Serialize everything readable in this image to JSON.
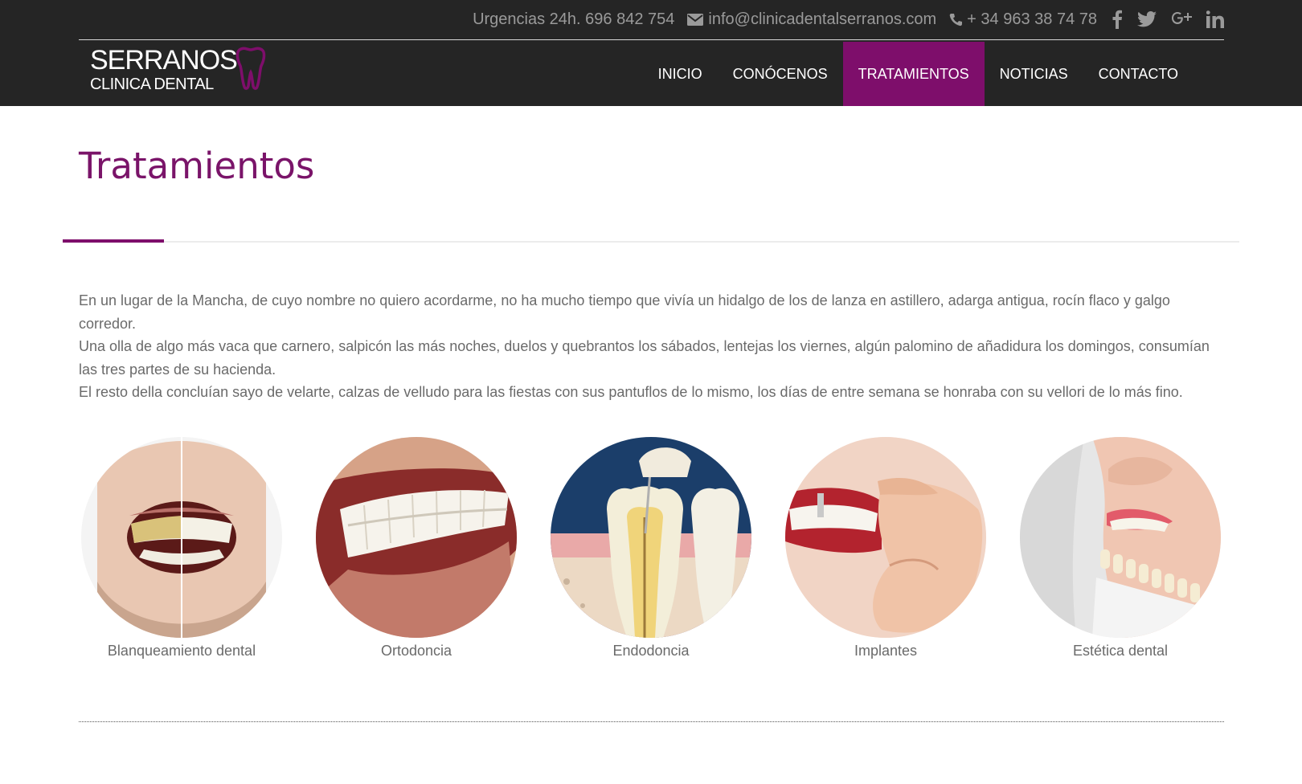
{
  "topbar": {
    "emergency": "Urgencias 24h. 696 842 754",
    "email": "info@clinicadentalserranos.com",
    "phone": "+ 34 963 38 74 78",
    "social_icons": [
      "facebook-icon",
      "twitter-icon",
      "google-plus-icon",
      "linkedin-icon"
    ]
  },
  "logo": {
    "line1": "SERRANOS",
    "line2": "CLINICA DENTAL"
  },
  "nav": {
    "items": [
      {
        "label": "INICIO"
      },
      {
        "label": "CONÓCENOS"
      },
      {
        "label": "TRATAMIENTOS",
        "active": true
      },
      {
        "label": "NOTICIAS"
      },
      {
        "label": "CONTACTO"
      }
    ]
  },
  "page": {
    "title": "Tratamientos",
    "paragraphs": [
      "En un lugar de la Mancha, de cuyo nombre no quiero acordarme, no ha mucho tiempo que vivía un hidalgo de los de lanza en astillero, adarga antigua, rocín flaco y galgo corredor.",
      "Una olla de algo más vaca que carnero, salpicón las más noches, duelos y quebrantos los sábados, lentejas los viernes, algún palomino de añadidura los domingos, consumían las tres partes de su hacienda.",
      "El resto della concluían sayo de velarte, calzas de velludo para las fiestas con sus pantuflos de lo mismo, los días de entre semana se honraba con su vellori de lo más fino."
    ]
  },
  "treatments": [
    {
      "label": "Blanqueamiento dental"
    },
    {
      "label": "Ortodoncia"
    },
    {
      "label": "Endodoncia"
    },
    {
      "label": "Implantes"
    },
    {
      "label": "Estética dental"
    }
  ],
  "colors": {
    "brand": "#7e0e6b",
    "header_bg": "#252525",
    "title": "#7a1469"
  }
}
